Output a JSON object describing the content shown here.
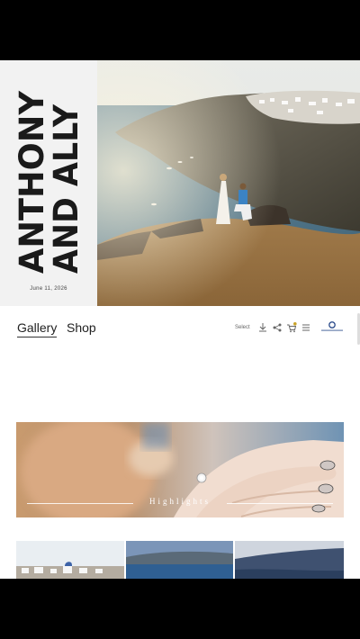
{
  "hero": {
    "title_line1": "ANTHONY",
    "title_line2": "AND ALLY",
    "date": "June 11, 2026"
  },
  "nav": {
    "tabs": [
      {
        "label": "Gallery",
        "active": true
      },
      {
        "label": "Shop",
        "active": false
      }
    ],
    "select_label": "Select",
    "icons": [
      "download-icon",
      "share-icon",
      "cart-icon",
      "menu-icon"
    ],
    "cart_badge": ""
  },
  "brand": {
    "logo_name": "studio-logo"
  },
  "highlights": {
    "label": "Highlights"
  },
  "colors": {
    "hero_panel": "#f2f2f2",
    "text_dark": "#222222",
    "cart_badge": "#c9a227",
    "logo_blue": "#2a4a8a"
  }
}
